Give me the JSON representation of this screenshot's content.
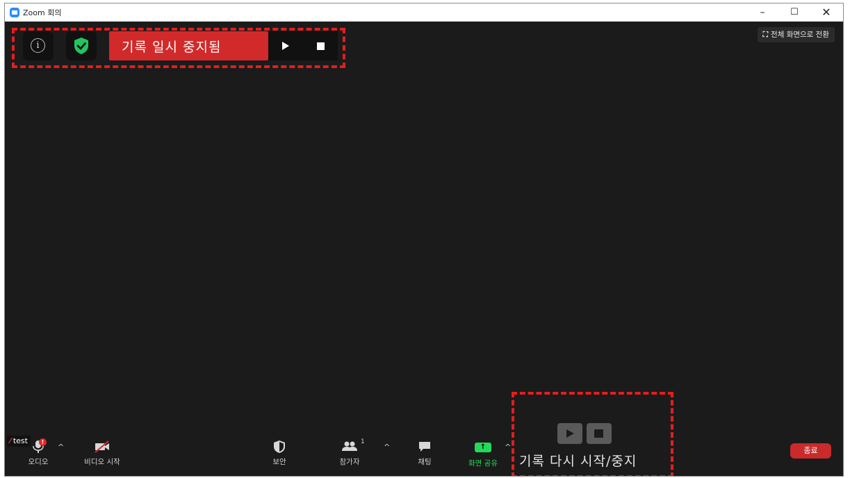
{
  "window": {
    "title": "Zoom 회의",
    "minimize_glyph": "–",
    "maximize_glyph": "☐",
    "close_glyph": "✕"
  },
  "top_bar": {
    "fullscreen_label": "전체 화면으로 전환",
    "fullscreen_icon": "⛶",
    "recording_status": "기록 일시 중지됨",
    "icons": [
      "info-icon",
      "shield-check-icon",
      "play-icon",
      "stop-icon"
    ]
  },
  "recording_hint": {
    "text": "기록 다시 시작/중지"
  },
  "participant": {
    "name": "test",
    "muted_icon": "mic-muted-icon"
  },
  "toolbar": {
    "audio_label": "오디오",
    "audio_badge": "!",
    "video_label": "비디오 시작",
    "security_label": "보안",
    "participants_label": "참가자",
    "participants_count": "1",
    "chat_label": "채팅",
    "share_label": "화면 공유",
    "end_label": "종료",
    "caret": "^"
  },
  "colors": {
    "background": "#1b1b1b",
    "recording_red": "#d22a2a",
    "share_green": "#23d959",
    "security_green": "#22c55e",
    "annotation_red": "#e41e1e",
    "end_button": "#c92a2a"
  }
}
